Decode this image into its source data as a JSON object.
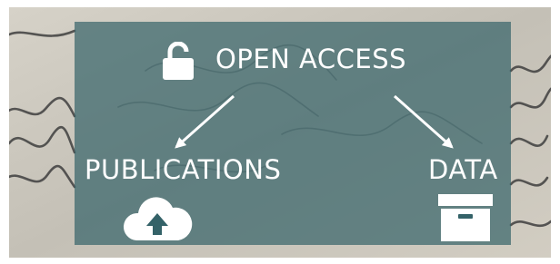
{
  "diagram": {
    "top": "OPEN ACCESS",
    "left": "PUBLICATIONS",
    "right": "DATA"
  },
  "icons": {
    "top": "unlocked-padlock-icon",
    "left": "cloud-upload-icon",
    "right": "archive-box-icon"
  },
  "colors": {
    "panel": "#346268",
    "text": "#ffffff",
    "background_paper": "#c8c4bb"
  }
}
